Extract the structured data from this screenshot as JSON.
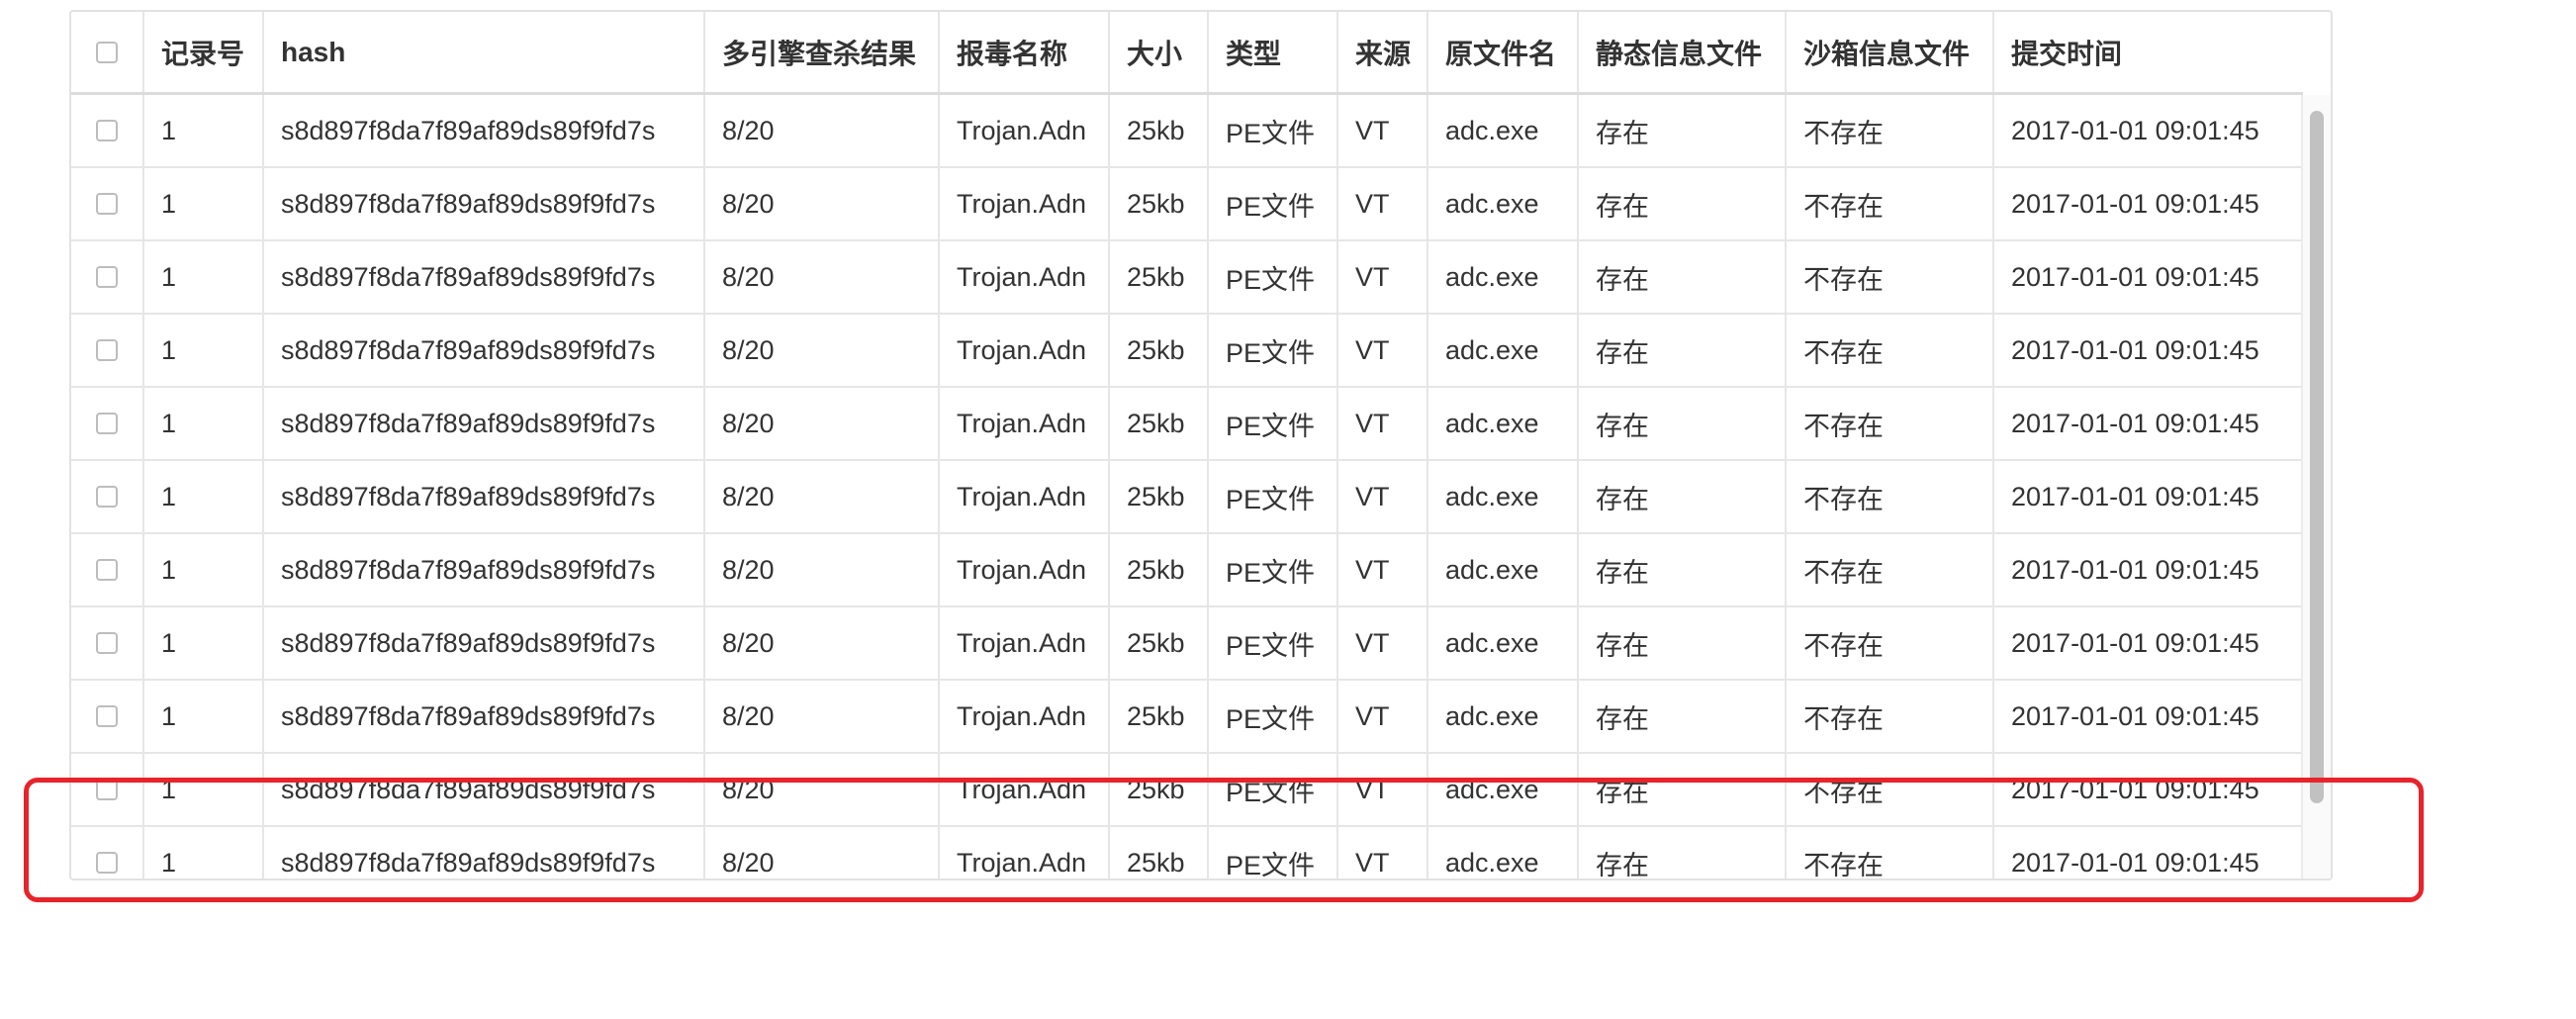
{
  "table": {
    "columns": [
      "",
      "记录号",
      "hash",
      "多引擎查杀结果",
      "报毒名称",
      "大小",
      "类型",
      "来源",
      "原文件名",
      "静态信息文件",
      "沙箱信息文件",
      "提交时间"
    ],
    "rows": [
      [
        "1",
        "s8d897f8da7f89af89ds89f9fd7s",
        "8/20",
        "Trojan.Adn",
        "25kb",
        "PE文件",
        "VT",
        "adc.exe",
        "存在",
        "不存在",
        "2017-01-01 09:01:45"
      ],
      [
        "1",
        "s8d897f8da7f89af89ds89f9fd7s",
        "8/20",
        "Trojan.Adn",
        "25kb",
        "PE文件",
        "VT",
        "adc.exe",
        "存在",
        "不存在",
        "2017-01-01 09:01:45"
      ],
      [
        "1",
        "s8d897f8da7f89af89ds89f9fd7s",
        "8/20",
        "Trojan.Adn",
        "25kb",
        "PE文件",
        "VT",
        "adc.exe",
        "存在",
        "不存在",
        "2017-01-01 09:01:45"
      ],
      [
        "1",
        "s8d897f8da7f89af89ds89f9fd7s",
        "8/20",
        "Trojan.Adn",
        "25kb",
        "PE文件",
        "VT",
        "adc.exe",
        "存在",
        "不存在",
        "2017-01-01 09:01:45"
      ],
      [
        "1",
        "s8d897f8da7f89af89ds89f9fd7s",
        "8/20",
        "Trojan.Adn",
        "25kb",
        "PE文件",
        "VT",
        "adc.exe",
        "存在",
        "不存在",
        "2017-01-01 09:01:45"
      ],
      [
        "1",
        "s8d897f8da7f89af89ds89f9fd7s",
        "8/20",
        "Trojan.Adn",
        "25kb",
        "PE文件",
        "VT",
        "adc.exe",
        "存在",
        "不存在",
        "2017-01-01 09:01:45"
      ],
      [
        "1",
        "s8d897f8da7f89af89ds89f9fd7s",
        "8/20",
        "Trojan.Adn",
        "25kb",
        "PE文件",
        "VT",
        "adc.exe",
        "存在",
        "不存在",
        "2017-01-01 09:01:45"
      ],
      [
        "1",
        "s8d897f8da7f89af89ds89f9fd7s",
        "8/20",
        "Trojan.Adn",
        "25kb",
        "PE文件",
        "VT",
        "adc.exe",
        "存在",
        "不存在",
        "2017-01-01 09:01:45"
      ],
      [
        "1",
        "s8d897f8da7f89af89ds89f9fd7s",
        "8/20",
        "Trojan.Adn",
        "25kb",
        "PE文件",
        "VT",
        "adc.exe",
        "存在",
        "不存在",
        "2017-01-01 09:01:45"
      ],
      [
        "1",
        "s8d897f8da7f89af89ds89f9fd7s",
        "8/20",
        "Trojan.Adn",
        "25kb",
        "PE文件",
        "VT",
        "adc.exe",
        "存在",
        "不存在",
        "2017-01-01 09:01:45"
      ],
      [
        "1",
        "s8d897f8da7f89af89ds89f9fd7s",
        "8/20",
        "Trojan.Adn",
        "25kb",
        "PE文件",
        "VT",
        "adc.exe",
        "存在",
        "不存在",
        "2017-01-01 09:01:45"
      ]
    ]
  },
  "colors": {
    "highlight": "#e8232a",
    "border": "#e6e6e6"
  }
}
